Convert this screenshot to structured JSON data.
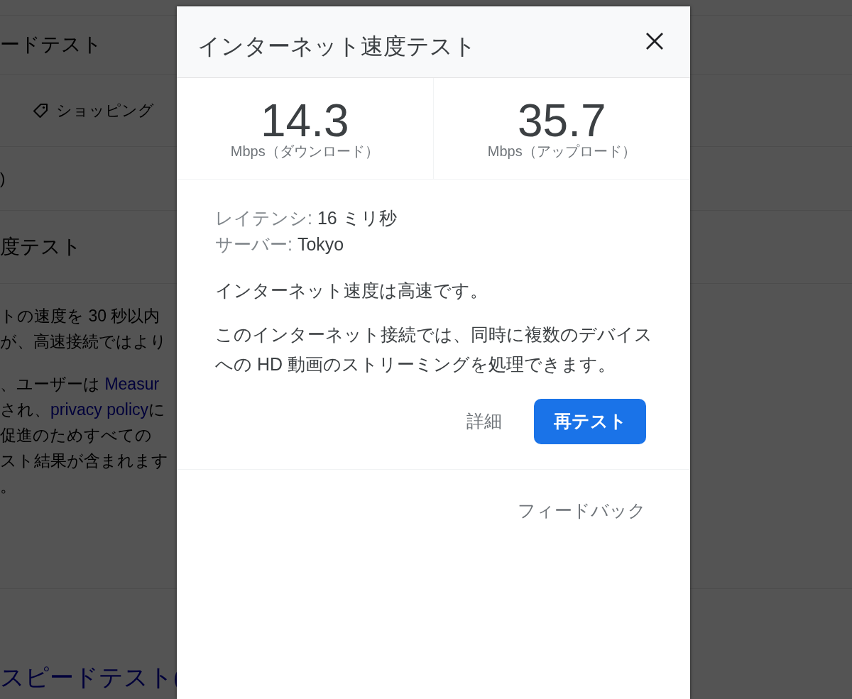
{
  "background_page": {
    "heading": "ードテスト",
    "tab": {
      "label": "ショッピング"
    },
    "note": ")",
    "section_title": "度テスト",
    "paragraphs": [
      [
        [
          {
            "kind": "text",
            "text": "トの速度を 30 秒以内"
          }
        ],
        [
          {
            "kind": "text",
            "text": "が、高速接続ではより"
          }
        ]
      ],
      [
        [
          {
            "kind": "text",
            "text": "、ユーザーは "
          },
          {
            "kind": "link",
            "text": "Measur"
          }
        ],
        [
          {
            "kind": "text",
            "text": "され、"
          },
          {
            "kind": "link",
            "text": "privacy policy"
          },
          {
            "kind": "text",
            "text": "に"
          }
        ],
        [
          {
            "kind": "text",
            "text": "促進のためすべての"
          }
        ],
        [
          {
            "kind": "text",
            "text": "スト結果が含まれます"
          }
        ],
        [
          {
            "kind": "text",
            "text": "。"
          }
        ]
      ]
    ],
    "related_title": "スピードテスト("
  },
  "dialog": {
    "title": "インターネット速度テスト",
    "results": [
      {
        "value": "14.3",
        "unit": "Mbps（ダウンロード）"
      },
      {
        "value": "35.7",
        "unit": "Mbps（アップロード）"
      }
    ],
    "details": [
      {
        "label": "レイテンシ:",
        "value": "16 ミリ秒"
      },
      {
        "label": "サーバー:",
        "value": "Tokyo"
      }
    ],
    "summary": "インターネット速度は高速です。",
    "description": "このインターネット接続では、同時に複数のデバイスへの HD 動画のストリーミングを処理できます。",
    "actions": [
      {
        "kind": "text",
        "label": "詳細"
      },
      {
        "kind": "primary",
        "label": "再テスト"
      }
    ],
    "feedback": "フィードバック"
  }
}
